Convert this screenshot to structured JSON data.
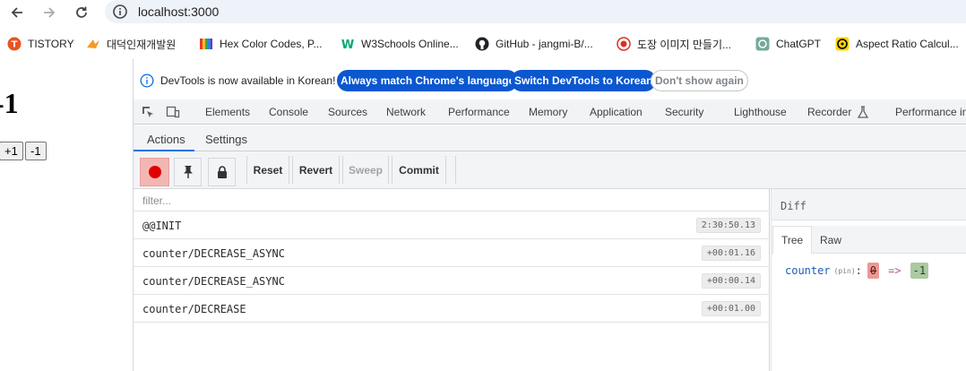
{
  "browser": {
    "url": "localhost:3000",
    "bookmarks": [
      {
        "label": "TISTORY",
        "icon": "tistory-icon"
      },
      {
        "label": "대덕인재개발원",
        "icon": "bird-logo-icon"
      },
      {
        "label": "Hex Color Codes, P...",
        "icon": "color-palette-icon"
      },
      {
        "label": "W3Schools Online...",
        "icon": "w3schools-icon"
      },
      {
        "label": "GitHub - jangmi-B/...",
        "icon": "github-icon"
      },
      {
        "label": "도장 이미지 만들기...",
        "icon": "stamp-icon"
      },
      {
        "label": "ChatGPT",
        "icon": "chatgpt-icon"
      },
      {
        "label": "Aspect Ratio Calcul...",
        "icon": "aspect-ratio-icon"
      }
    ]
  },
  "page": {
    "counter": "-1",
    "inc_label": "+1",
    "dec_label": "-1"
  },
  "devtools": {
    "info": {
      "text": "DevTools is now available in Korean!",
      "match_label": "Always match Chrome's language",
      "switch_label": "Switch DevTools to Korean",
      "dismiss_label": "Don't show again"
    },
    "tabs": [
      "Elements",
      "Console",
      "Sources",
      "Network",
      "Performance",
      "Memory",
      "Application",
      "Security",
      "Lighthouse",
      "Recorder",
      "Performance in"
    ],
    "redux": {
      "tabs": [
        "Actions",
        "Settings"
      ],
      "buttons": {
        "reset": "Reset",
        "revert": "Revert",
        "sweep": "Sweep",
        "commit": "Commit"
      },
      "filter_placeholder": "filter...",
      "actions": [
        {
          "name": "@@INIT",
          "time": "2:30:50.13"
        },
        {
          "name": "counter/DECREASE_ASYNC",
          "time": "+00:01.16"
        },
        {
          "name": "counter/DECREASE_ASYNC",
          "time": "+00:00.14"
        },
        {
          "name": "counter/DECREASE",
          "time": "+00:01.00"
        }
      ],
      "diff": {
        "title": "Diff",
        "tabs": [
          "Tree",
          "Raw"
        ],
        "key": "counter",
        "pin": "(pin)",
        "colon": ":",
        "old": "0",
        "arrow": "=>",
        "new": "-1"
      }
    }
  },
  "colors": {
    "accent": "#0b57d0",
    "tab_underline": "#1a73e8",
    "record": "#e10000",
    "diff_removed": "#ec9995",
    "diff_added": "#acc9a2"
  }
}
